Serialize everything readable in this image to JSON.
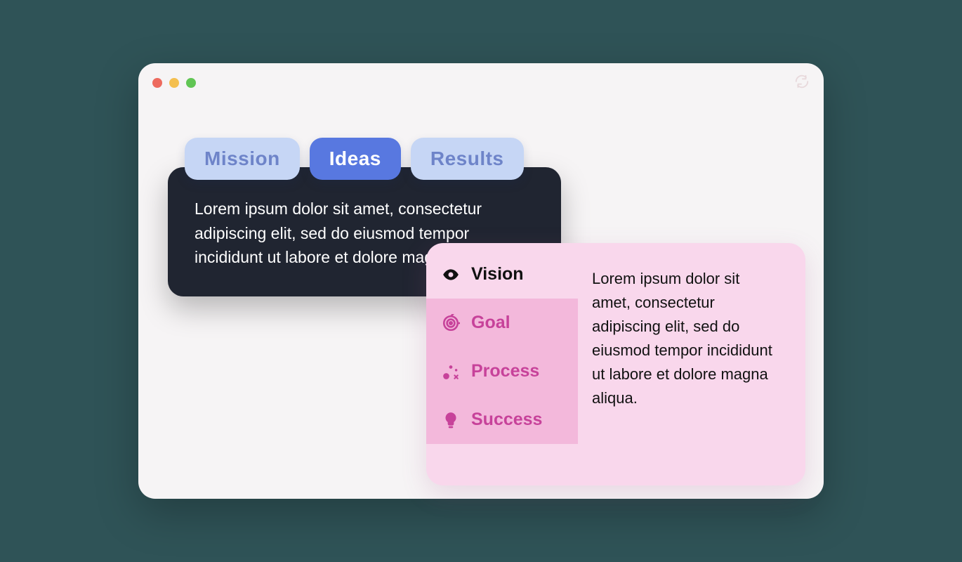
{
  "window": {
    "refresh_icon": "refresh"
  },
  "darkCard": {
    "tabs": [
      {
        "label": "Mission",
        "active": false
      },
      {
        "label": "Ideas",
        "active": true
      },
      {
        "label": "Results",
        "active": false
      }
    ],
    "body": "Lorem ipsum dolor sit amet, consectetur adipiscing elit, sed do eiusmod tempor incididunt ut labore et dolore magna aliqua."
  },
  "pinkCard": {
    "tabs": [
      {
        "label": "Vision",
        "icon": "eye",
        "active": true
      },
      {
        "label": "Goal",
        "icon": "target",
        "active": false
      },
      {
        "label": "Process",
        "icon": "nodes",
        "active": false
      },
      {
        "label": "Success",
        "icon": "bulb",
        "active": false
      }
    ],
    "body": "Lorem ipsum dolor sit amet, consectetur adipiscing elit, sed do eiusmod tempor incididunt ut labore et dolore magna aliqua."
  }
}
